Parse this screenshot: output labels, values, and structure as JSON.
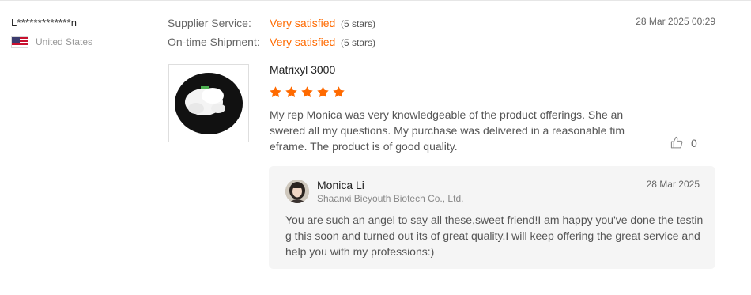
{
  "reviewer": {
    "name": "L*************n",
    "country": "United States",
    "flag_icon": "us-flag-icon"
  },
  "ratings": [
    {
      "label": "Supplier Service:",
      "value": "Very satisfied",
      "stars": "(5 stars)"
    },
    {
      "label": "On-time Shipment:",
      "value": "Very satisfied",
      "stars": "(5 stars)"
    }
  ],
  "review_date": "28 Mar 2025 00:29",
  "product": {
    "name": "Matrixyl 3000",
    "thumbnail_icon": "white-powder-product-image",
    "rating": 5,
    "rating_max": 5
  },
  "review_text": "My rep Monica was very knowledgeable of the product offerings.  She answered all my questions.  My purchase was delivered in a reasonable timeframe. The product is of good quality.",
  "likes": {
    "count": "0",
    "icon": "thumbs-up-icon"
  },
  "reply": {
    "author": "Monica Li",
    "company": "Shaanxi Bieyouth Biotech Co., Ltd.",
    "date": "28 Mar 2025",
    "text": "You are such an angel to say all these,sweet friend!I am happy you've done the testing this soon and turned out its of great quality.I will keep offering the great service and help you with my professions:)"
  },
  "colors": {
    "accent": "#ff6a00",
    "star": "#ff6a00",
    "reply_background": "#f5f5f5",
    "muted_text": "#999999"
  }
}
